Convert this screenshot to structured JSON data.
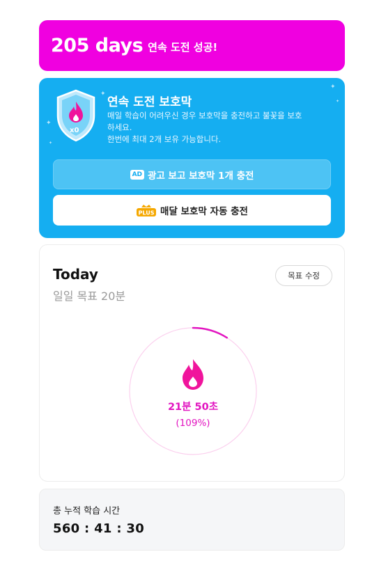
{
  "streak": {
    "days": "205 days",
    "text": "연속 도전 성공!"
  },
  "shield": {
    "title": "연속 도전 보호막",
    "count_label": "x0",
    "desc_line1": "매일 학습이 어려우신 경우 보호막을 충전하고 불꽃을 보호",
    "desc_line2": "하세요.",
    "desc_line3": "한번에 최대 2개 보유 가능합니다.",
    "ad_badge": "AD",
    "ad_button": "광고 보고 보호막 1개 충전",
    "plus_badge": "PLUS",
    "plus_button": "매달 보호막 자동 충전"
  },
  "today": {
    "title": "Today",
    "goal": "일일 목표 20분",
    "edit_button": "목표 수정",
    "time_done": "21분 50초",
    "percent": "(109%)",
    "progress_fraction": 1.09
  },
  "total": {
    "label": "총 누적 학습 시간",
    "value": "560 : 41 : 30"
  },
  "colors": {
    "streak": "#f000e0",
    "shield": "#15aef1",
    "accent": "#e215c0"
  }
}
